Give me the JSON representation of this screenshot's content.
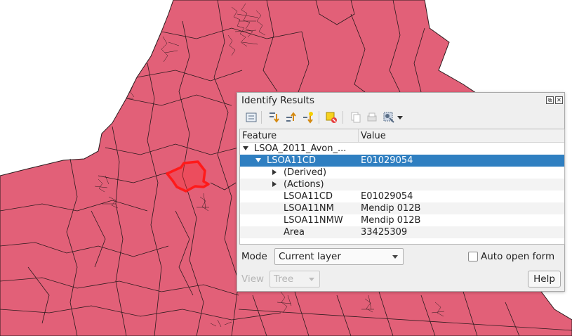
{
  "map": {
    "fill_color": "#e26078",
    "stroke_color": "#2b1a1d",
    "highlight_color": "#ff1a1a",
    "background_color": "#ffffff"
  },
  "panel": {
    "title": "Identify Results",
    "title_buttons": [
      "restore-icon",
      "close-icon"
    ],
    "toolbar": [
      "expand-tree-icon",
      "expand-all-icon",
      "collapse-all-icon",
      "expand-new-results-icon",
      "clear-highlights-icon",
      "copy-feature-icon",
      "print-icon",
      "select-features-icon"
    ],
    "columns": {
      "feature": "Feature",
      "value": "Value"
    },
    "rows": [
      {
        "feature": "LSOA_2011_Avon_...",
        "value": "",
        "arrow": "down",
        "indent": 0,
        "selected": false
      },
      {
        "feature": "LSOA11CD",
        "value": "E01029054",
        "arrow": "down",
        "indent": 1,
        "selected": true
      },
      {
        "feature": "(Derived)",
        "value": "",
        "arrow": "right",
        "indent": 2,
        "selected": false
      },
      {
        "feature": "(Actions)",
        "value": "",
        "arrow": "right",
        "indent": 2,
        "selected": false
      },
      {
        "feature": "LSOA11CD",
        "value": "E01029054",
        "arrow": "",
        "indent": 2,
        "selected": false
      },
      {
        "feature": "LSOA11NM",
        "value": "Mendip 012B",
        "arrow": "",
        "indent": 2,
        "selected": false
      },
      {
        "feature": "LSOA11NMW",
        "value": "Mendip 012B",
        "arrow": "",
        "indent": 2,
        "selected": false
      },
      {
        "feature": "Area",
        "value": "33425309",
        "arrow": "",
        "indent": 2,
        "selected": false
      }
    ],
    "mode_label": "Mode",
    "mode_value": "Current layer",
    "auto_open_label": "Auto open form",
    "auto_open_checked": false,
    "view_label": "View",
    "view_value": "Tree",
    "help_label": "Help",
    "selection_color": "#2f7fc1"
  }
}
